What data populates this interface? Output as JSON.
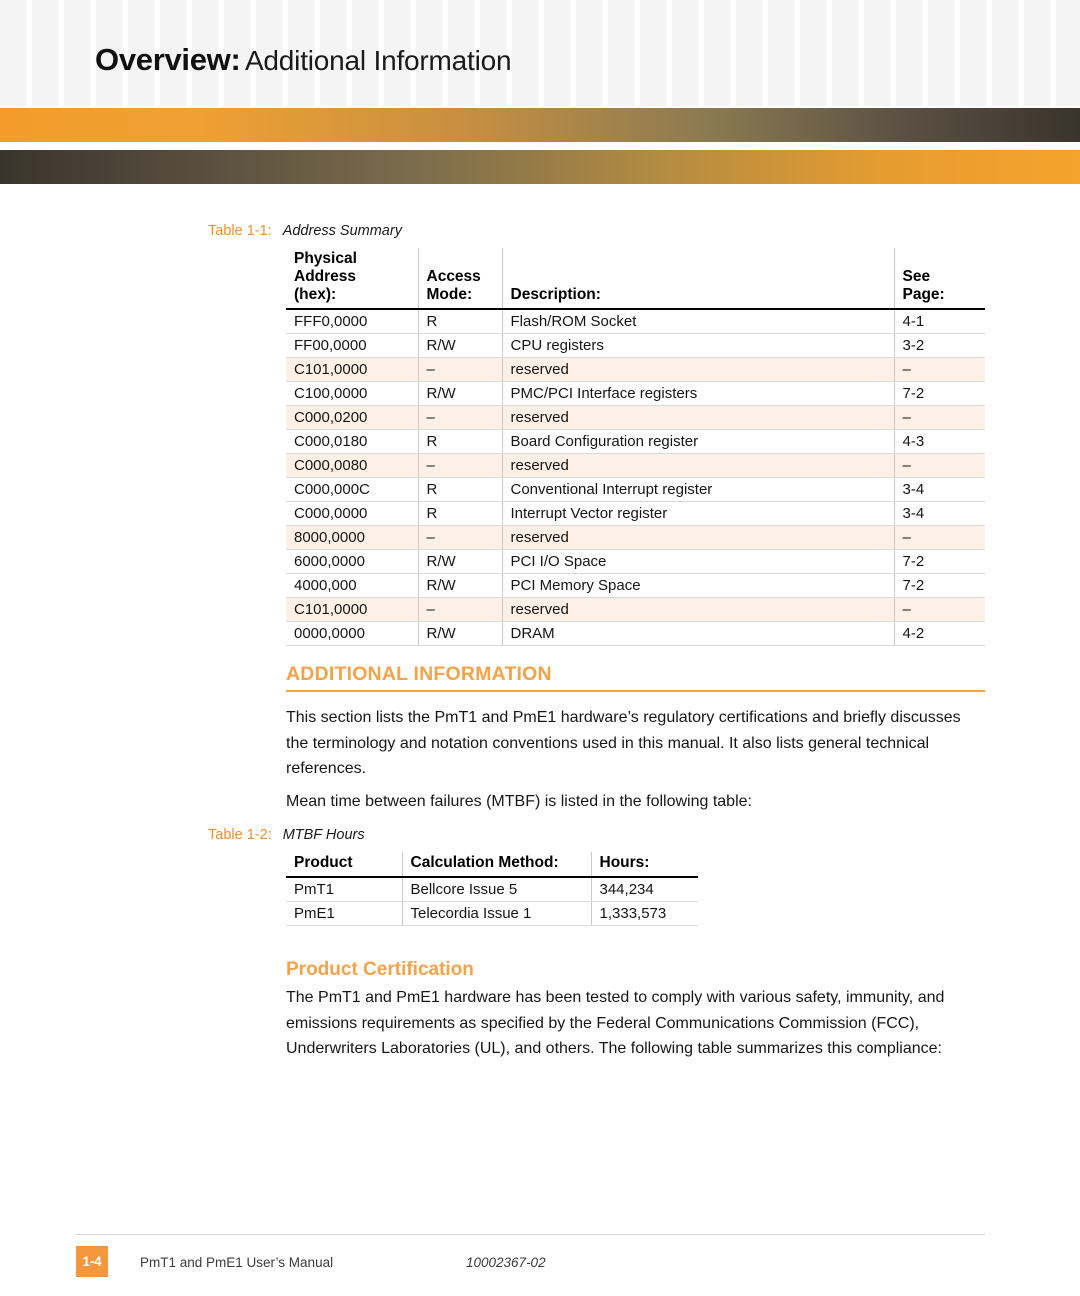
{
  "header": {
    "title_bold": "Overview:",
    "title_light": "Additional Information",
    "bar_top_gradient_from": "#f39c2a",
    "bar_top_gradient_to": "#3b342c",
    "bar_bottom_gradient_from": "#3b342c",
    "bar_bottom_gradient_to": "#f5a32c"
  },
  "accent_color": "#f5a349",
  "caption_color": "#f0912c",
  "alt_row_color": "#fdf1e7",
  "table_1": {
    "caption_label": "Table 1-1:",
    "caption_text": "Address Summary",
    "columns": [
      "Physical Address (hex):",
      "Access Mode:",
      "Description:",
      "See Page:"
    ],
    "columns_lines": [
      [
        "Physical Address",
        "(hex):"
      ],
      [
        "Access",
        "Mode:"
      ],
      [
        "",
        "Description:"
      ],
      [
        "See",
        "Page:"
      ]
    ],
    "rows": [
      {
        "address": "FFF0,0000",
        "access": "R",
        "description": "Flash/ROM Socket",
        "page": "4-1",
        "alt": false
      },
      {
        "address": "FF00,0000",
        "access": "R/W",
        "description": "CPU registers",
        "page": "3-2",
        "alt": false
      },
      {
        "address": "C101,0000",
        "access": "–",
        "description": "reserved",
        "page": "–",
        "alt": true
      },
      {
        "address": "C100,0000",
        "access": "R/W",
        "description": "PMC/PCI Interface registers",
        "page": "7-2",
        "alt": false
      },
      {
        "address": "C000,0200",
        "access": "–",
        "description": "reserved",
        "page": "–",
        "alt": true
      },
      {
        "address": "C000,0180",
        "access": "R",
        "description": "Board Configuration register",
        "page": "4-3",
        "alt": false
      },
      {
        "address": "C000,0080",
        "access": "–",
        "description": "reserved",
        "page": "–",
        "alt": true
      },
      {
        "address": "C000,000C",
        "access": "R",
        "description": "Conventional Interrupt register",
        "page": "3-4",
        "alt": false
      },
      {
        "address": "C000,0000",
        "access": "R",
        "description": "Interrupt Vector register",
        "page": "3-4",
        "alt": false
      },
      {
        "address": "8000,0000",
        "access": "–",
        "description": "reserved",
        "page": "–",
        "alt": true
      },
      {
        "address": "6000,0000",
        "access": "R/W",
        "description": "PCI I/O Space",
        "page": "7-2",
        "alt": false
      },
      {
        "address": "4000,000",
        "access": "R/W",
        "description": "PCI Memory Space",
        "page": "7-2",
        "alt": false
      },
      {
        "address": "C101,0000",
        "access": "–",
        "description": "reserved",
        "page": "–",
        "alt": true
      },
      {
        "address": "0000,0000",
        "access": "R/W",
        "description": "DRAM",
        "page": "4-2",
        "alt": false
      }
    ]
  },
  "section": {
    "heading": "ADDITIONAL INFORMATION",
    "paragraph_1": "This section lists the PmT1 and PmE1 hardware’s regulatory certifications and briefly discusses the terminology and notation conventions used in this manual. It also lists general technical references.",
    "paragraph_2": "Mean time between failures (MTBF) is listed in the following table:"
  },
  "table_2": {
    "caption_label": "Table 1-2:",
    "caption_text": "MTBF Hours",
    "columns": [
      "Product",
      "Calculation Method:",
      "Hours:"
    ],
    "rows": [
      {
        "product": "PmT1",
        "method": "Bellcore Issue 5",
        "hours": "344,234"
      },
      {
        "product": "PmE1",
        "method": "Telecordia Issue 1",
        "hours": "1,333,573"
      }
    ]
  },
  "certification": {
    "heading": "Product Certification",
    "paragraph": "The PmT1 and PmE1 hardware has been tested to comply with various safety, immunity, and emissions requirements as specified by the Federal Communications Commission (FCC), Underwriters Laboratories (UL), and others. The following table summarizes this compliance:"
  },
  "footer": {
    "page_number": "1-4",
    "manual_title": "PmT1 and PmE1 User’s Manual",
    "document_number": "10002367-02"
  }
}
